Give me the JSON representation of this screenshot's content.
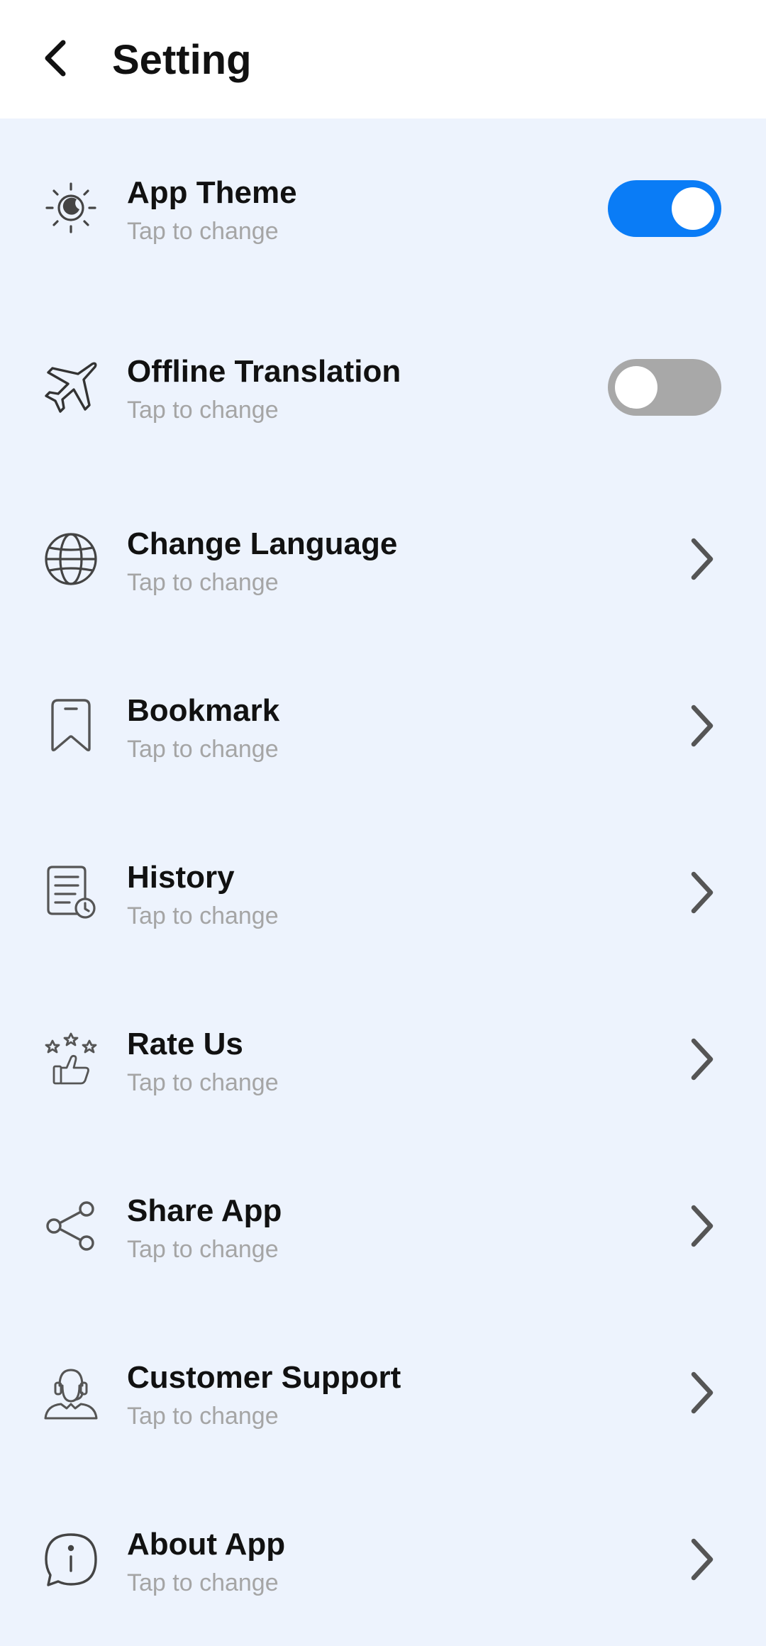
{
  "header": {
    "title": "Setting",
    "back_icon": "arrow-back-icon"
  },
  "colors": {
    "accent": "#0a7cf6",
    "toggle_off": "#a8a8a8",
    "background": "#edf3fd",
    "subtitle": "#a5a5a5"
  },
  "settings": [
    {
      "title": "App Theme",
      "subtitle": "Tap to change",
      "icon": "theme-sun-moon-icon",
      "control": "toggle",
      "toggle_on": true
    },
    {
      "title": "Offline Translation",
      "subtitle": "Tap to change",
      "icon": "airplane-icon",
      "control": "toggle",
      "toggle_on": false
    },
    {
      "title": "Change Language",
      "subtitle": "Tap to change",
      "icon": "globe-icon",
      "control": "chevron"
    },
    {
      "title": "Bookmark",
      "subtitle": "Tap to change",
      "icon": "bookmark-icon",
      "control": "chevron"
    },
    {
      "title": "History",
      "subtitle": "Tap to change",
      "icon": "history-document-icon",
      "control": "chevron"
    },
    {
      "title": "Rate Us",
      "subtitle": "Tap to change",
      "icon": "rate-stars-thumbs-up-icon",
      "control": "chevron"
    },
    {
      "title": "Share App",
      "subtitle": "Tap to change",
      "icon": "share-icon",
      "control": "chevron"
    },
    {
      "title": "Customer Support",
      "subtitle": "Tap to change",
      "icon": "support-agent-headset-icon",
      "control": "chevron"
    },
    {
      "title": "About App",
      "subtitle": "Tap to change",
      "icon": "info-chat-icon",
      "control": "chevron"
    }
  ]
}
